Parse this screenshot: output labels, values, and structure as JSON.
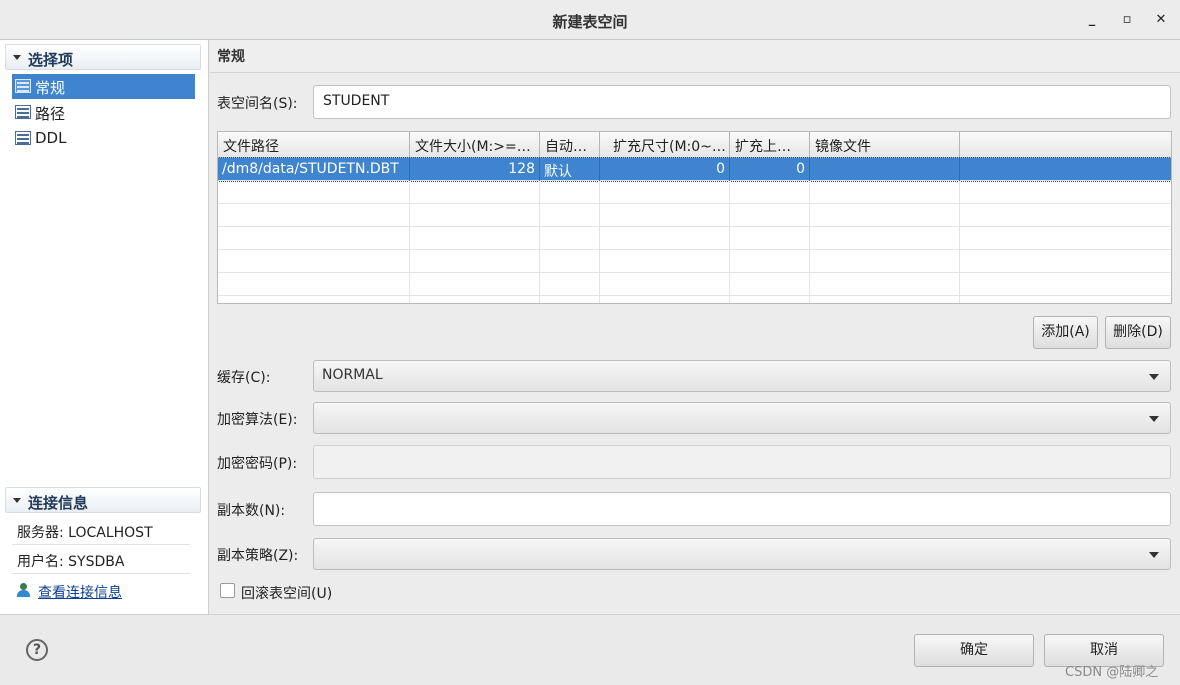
{
  "window": {
    "title": "新建表空间",
    "minimize_glyph": "_",
    "maximize_glyph": "▫",
    "close_glyph": "✕"
  },
  "sidebar": {
    "section_options": "选择项",
    "items": [
      {
        "label": "常规",
        "selected": true,
        "icon": "table-icon"
      },
      {
        "label": "路径",
        "selected": false,
        "icon": "table-icon"
      },
      {
        "label": "DDL",
        "selected": false,
        "icon": "table-icon"
      }
    ],
    "section_connection": "连接信息",
    "server": "服务器: LOCALHOST",
    "user": "用户名: SYSDBA",
    "view_connection_link": "查看连接信息"
  },
  "main": {
    "header": "常规",
    "tablespace_name_label": "表空间名(S):",
    "tablespace_name_value": "STUDENT",
    "table": {
      "columns": [
        "文件路径",
        "文件大小(M:>=…",
        "自动…",
        "扩充尺寸(M:0~…",
        "扩充上…",
        "镜像文件"
      ],
      "rows": [
        [
          "/dm8/data/STUDETN.DBT",
          "128",
          "默认",
          "0",
          "0",
          ""
        ]
      ]
    },
    "add_button": "添加(A)",
    "delete_button": "删除(D)",
    "cache_label": "缓存(C):",
    "cache_value": "NORMAL",
    "encrypt_algo_label": "加密算法(E):",
    "encrypt_algo_value": "",
    "encrypt_pwd_label": "加密密码(P):",
    "replica_count_label": "副本数(N):",
    "replica_policy_label": "副本策略(Z):",
    "replica_policy_value": "",
    "rollback_checkbox_label": "回滚表空间(U)",
    "rollback_checked": false
  },
  "footer": {
    "help_glyph": "?",
    "ok_button": "确定",
    "cancel_button": "取消",
    "watermark": "CSDN @陆卿之"
  },
  "colors": {
    "selection": "#3e84cf",
    "link": "#0b3f92"
  }
}
